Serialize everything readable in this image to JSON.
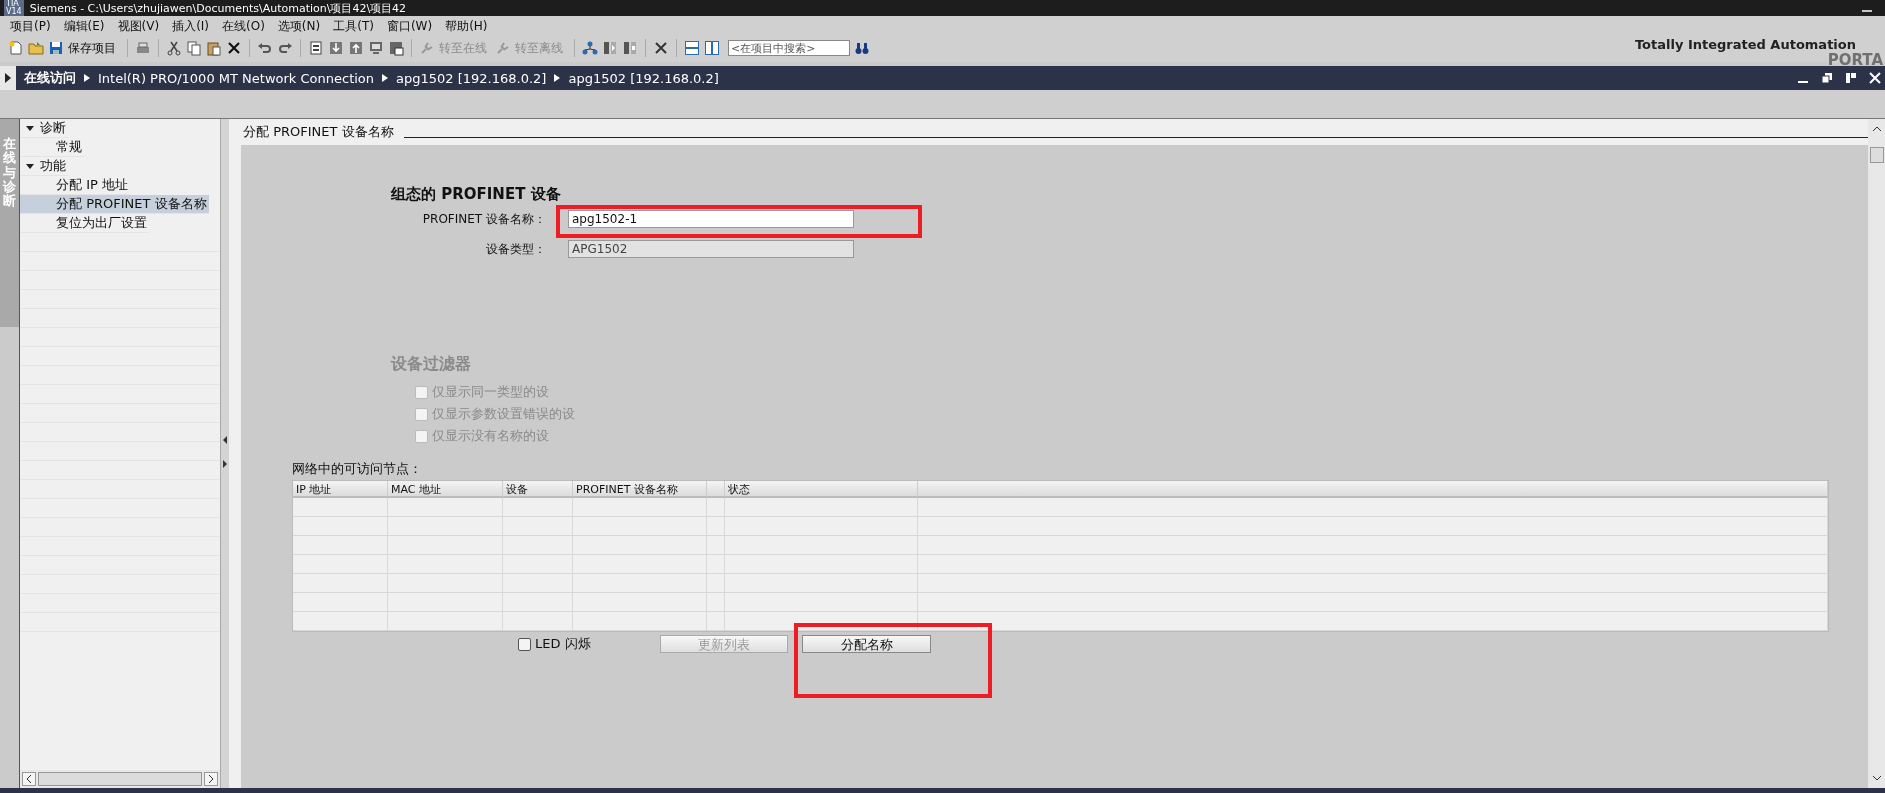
{
  "window": {
    "title": "Siemens  -  C:\\Users\\zhujiawen\\Documents\\Automation\\项目42\\项目42",
    "badge_lines": [
      "TIA",
      "V14"
    ]
  },
  "menu": [
    "项目(P)",
    "编辑(E)",
    "视图(V)",
    "插入(I)",
    "在线(O)",
    "选项(N)",
    "工具(T)",
    "窗口(W)",
    "帮助(H)"
  ],
  "toolbar": {
    "save_label": "保存项目",
    "go_online": {
      "label": "转至在线",
      "disabled": true
    },
    "go_offline": {
      "label": "转至离线",
      "disabled": true
    },
    "search": {
      "placeholder": "<在项目中搜索>"
    }
  },
  "brand": {
    "title": "Totally Integrated Automation",
    "subtitle": "PORTA"
  },
  "breadcrumb": [
    "在线访问",
    "Intel(R) PRO/1000 MT Network Connection",
    "apg1502 [192.168.0.2]",
    "apg1502 [192.168.0.2]"
  ],
  "side_tab": {
    "label": "在线与诊断"
  },
  "tree": [
    {
      "label": "诊断",
      "expanded": true,
      "selected": false,
      "children": [
        {
          "label": "常规",
          "selected": false
        }
      ]
    },
    {
      "label": "功能",
      "expanded": true,
      "selected": false,
      "children": [
        {
          "label": "分配 IP 地址",
          "selected": false
        },
        {
          "label": "分配 PROFINET 设备名称",
          "selected": true
        },
        {
          "label": "复位为出厂设置",
          "selected": false
        }
      ]
    }
  ],
  "section": {
    "title": "分配 PROFINET 设备名称"
  },
  "configured": {
    "heading": "组态的 PROFINET 设备",
    "fields": [
      {
        "label": "PROFINET 设备名称：",
        "value": "apg1502-1",
        "disabled": false
      },
      {
        "label": "设备类型：",
        "value": "APG1502",
        "disabled": true
      }
    ]
  },
  "filter": {
    "heading": "设备过滤器",
    "disabled": true,
    "options": [
      {
        "label": "仅显示同一类型的设",
        "checked": false
      },
      {
        "label": "仅显示参数设置错误的设",
        "checked": false
      },
      {
        "label": "仅显示没有名称的设",
        "checked": false
      }
    ]
  },
  "nodes": {
    "caption": "网络中的可访问节点：",
    "columns": [
      "IP 地址",
      "MAC 地址",
      "设备",
      "PROFINET 设备名称",
      "状态"
    ]
  },
  "led": {
    "label": "LED 闪烁",
    "checked": false
  },
  "buttons": [
    {
      "label": "更新列表",
      "disabled": true
    },
    {
      "label": "分配名称",
      "disabled": false
    }
  ]
}
